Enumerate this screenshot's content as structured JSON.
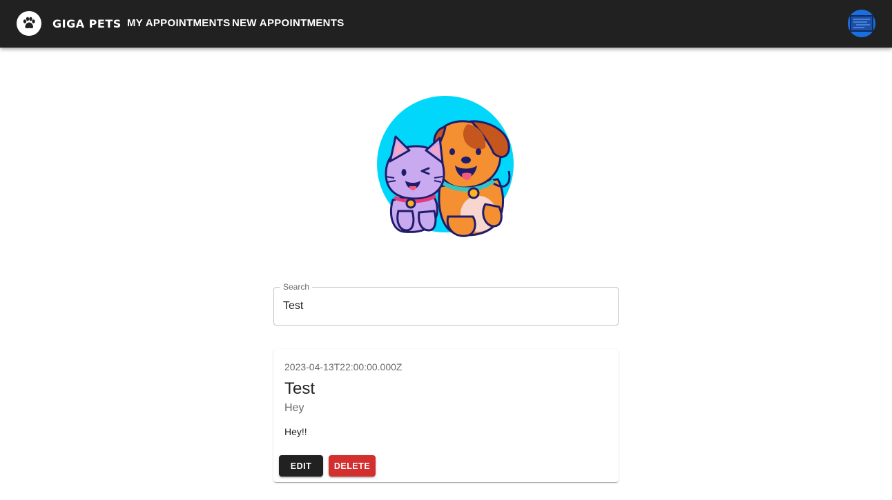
{
  "header": {
    "brand": "GIGA PETS",
    "logo_icon": "paw-icon",
    "nav": {
      "my_appointments": "MY APPOINTMENTS",
      "new_appointments": "NEW APPOINTMENTS"
    },
    "avatar_icon": "user-avatar-icon",
    "colors": {
      "bar": "#212121",
      "avatar": "#1a6fe0"
    }
  },
  "hero": {
    "illustration": "cat-and-dog-illustration",
    "colors": {
      "circle": "#00d7fb",
      "cat": "#c9a9f0",
      "dog": "#f59032"
    }
  },
  "search": {
    "label": "Search",
    "value": "Test"
  },
  "appointments": [
    {
      "date": "2023-04-13T22:00:00.000Z",
      "title": "Test",
      "subtitle": "Hey",
      "description": "Hey!!",
      "edit_label": "EDIT",
      "delete_label": "DELETE"
    }
  ],
  "colors": {
    "edit_button": "#212121",
    "delete_button": "#d32f2f"
  }
}
